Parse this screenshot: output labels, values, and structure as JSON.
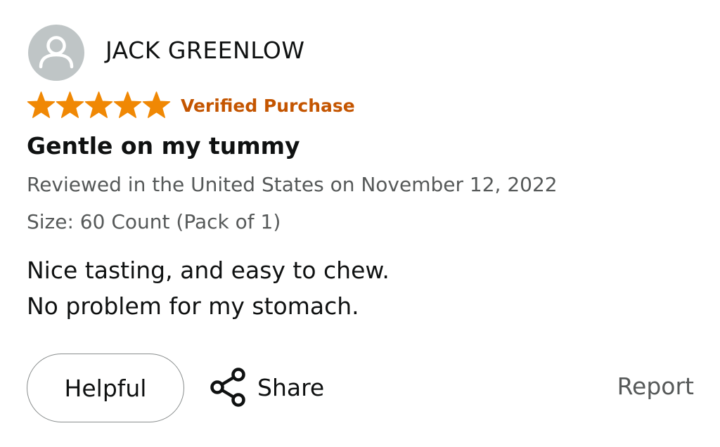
{
  "reviewer": {
    "name": "JACK GREENLOW",
    "avatar_icon": "default-user-avatar-icon"
  },
  "rating": {
    "stars": 5,
    "max_stars": 5,
    "star_icon": "star-icon",
    "star_color": "#f08804",
    "badge": "Verified Purchase",
    "badge_color": "#c45500"
  },
  "review": {
    "title": "Gentle on my tummy",
    "date_line": "Reviewed in the United States on November 12, 2022",
    "variant": "Size: 60 Count (Pack of 1)",
    "body_lines": [
      "Nice tasting, and easy to chew.",
      "No problem for my stomach."
    ]
  },
  "actions": {
    "helpful_label": "Helpful",
    "share_label": "Share",
    "share_icon": "share-icon",
    "report_label": "Report"
  }
}
